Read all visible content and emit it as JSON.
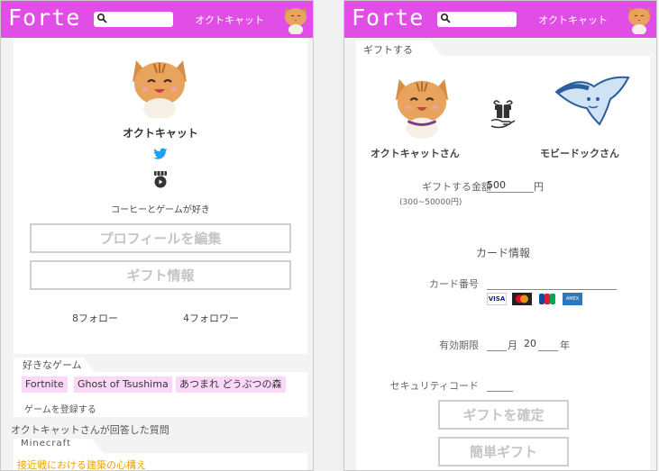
{
  "app": {
    "logo": "Forte",
    "search_placeholder": ""
  },
  "header": {
    "username": "オクトキャット"
  },
  "profile": {
    "name": "オクトキャット",
    "bio": "コーヒーとゲームが好き",
    "edit_button": "プロフィールを編集",
    "gift_info_button": "ギフト情報",
    "follow_count": "8フォロー",
    "follower_count": "4フォロワー"
  },
  "games": {
    "title": "好きなゲーム",
    "items": [
      "Fortnite",
      "Ghost of Tsushima",
      "あつまれ どうぶつの森"
    ],
    "register_link": "ゲームを登録する"
  },
  "answered": {
    "title": "オクトキャットさんが回答した質問",
    "tag": "Minecraft",
    "question": "接近戦における建築の心構え"
  },
  "gift": {
    "tab": "ギフトする",
    "from_name": "オクトキャットさん",
    "to_name": "モビードックさん",
    "amount_label": "ギフトする金額",
    "amount_range": "(300~50000円)",
    "amount_value": "500",
    "currency": "円",
    "card_info_title": "カード情報",
    "card_number_label": "カード番号",
    "card_brands": [
      "VISA",
      "MasterCard",
      "JCB",
      "AMEX"
    ],
    "expiry_label": "有効期限",
    "expiry_month": "",
    "month_unit": "月",
    "expiry_year_prefix": "20",
    "year_unit": "年",
    "security_label": "セキュリティコード",
    "confirm_button": "ギフトを確定",
    "easy_button": "簡単ギフト"
  },
  "colors": {
    "brand": "#e14ee6",
    "chip": "#fbd8f8",
    "link": "#e8a400",
    "twitter": "#1da1f2"
  }
}
